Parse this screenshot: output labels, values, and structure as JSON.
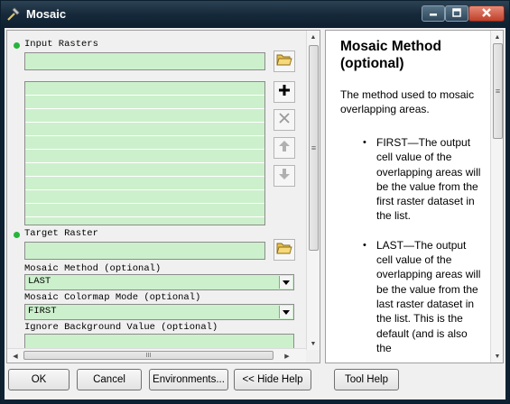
{
  "window": {
    "title": "Mosaic",
    "icons": {
      "app": "hammer-icon",
      "minimize": "minimize-icon",
      "maximize": "maximize-icon",
      "close": "close-icon"
    }
  },
  "params": {
    "input_rasters": {
      "label": "Input Rasters",
      "value": "",
      "list_rows": 10
    },
    "target_raster": {
      "label": "Target Raster",
      "value": ""
    },
    "mosaic_method": {
      "label": "Mosaic Method (optional)",
      "value": "LAST"
    },
    "colormap_mode": {
      "label": "Mosaic Colormap Mode (optional)",
      "value": "FIRST"
    },
    "ignore_background": {
      "label": "Ignore Background Value (optional)",
      "value": ""
    }
  },
  "list_buttons": {
    "icons": [
      "add-icon",
      "remove-icon",
      "move-up-icon",
      "move-down-icon"
    ]
  },
  "scrollbar": {
    "grip": "III",
    "grip_v": "≡"
  },
  "help": {
    "title": "Mosaic Method (optional)",
    "description": "The method used to mosaic overlapping areas.",
    "items": [
      "FIRST—The output cell value of the overlapping areas will be the value from the first raster dataset in the list.",
      "LAST—The output cell value of the overlapping areas will be the value from the last raster dataset in the list. This is the default (and is also the"
    ],
    "bullet": "•"
  },
  "buttons": {
    "ok": "OK",
    "cancel": "Cancel",
    "environments": "Environments...",
    "hide_help": "<< Hide Help",
    "tool_help": "Tool Help"
  },
  "colors": {
    "field_green": "#ccf0cc",
    "required_dot": "#27b43a",
    "title_bar": "#16293a"
  }
}
